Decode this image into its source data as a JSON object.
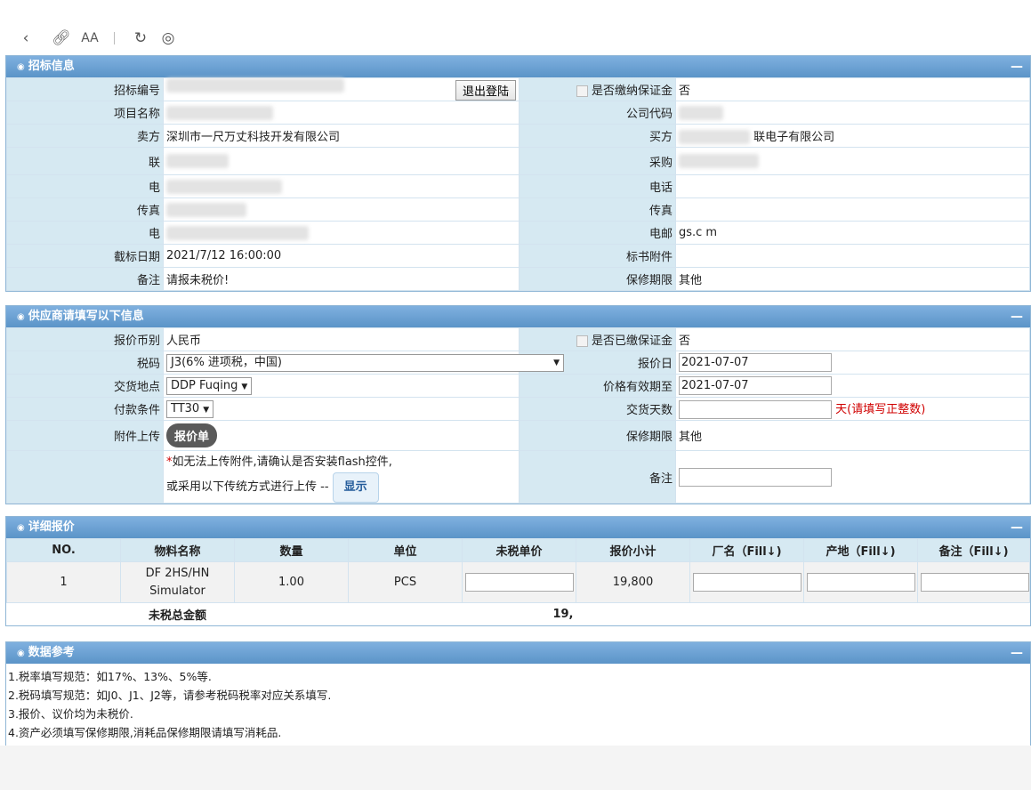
{
  "toolbar": {
    "icons": [
      "back-icon",
      "link-icon",
      "text-size-icon",
      "refresh-icon",
      "compass-icon"
    ],
    "text_size_glyph": "AA"
  },
  "bid_info": {
    "title": "招标信息",
    "collapse": "—",
    "bid_no_label": "招标编号",
    "logout_button": "退出登陆",
    "deposit_label": "是否缴纳保证金",
    "deposit_value": "否",
    "project_label": "项目名称",
    "company_code_label": "公司代码",
    "seller_label": "卖方",
    "seller_value": "深圳市一尺万丈科技开发有限公司",
    "buyer_label": "买方",
    "buyer_value": "联电子有限公司",
    "contact_label": "联",
    "purchaser_label": "采购",
    "phone_label_left": "电",
    "phone_label_right": "电话",
    "fax_label_left": "传真",
    "fax_label_right": "传真",
    "email_label_left": "电",
    "email_label_right": "电邮",
    "email_value_right": "gs.c  m",
    "deadline_label": "截标日期",
    "deadline_value": "2021/7/12 16:00:00",
    "attachment_label": "标书附件",
    "remark_label": "备注",
    "remark_value": "请报未税价!",
    "warranty_label": "保修期限",
    "warranty_value": "其他"
  },
  "supplier_info": {
    "title": "供应商请填写以下信息",
    "collapse": "—",
    "currency_label": "报价币别",
    "currency_value": "人民币",
    "deposit_label": "是否已缴保证金",
    "deposit_value": "否",
    "tax_label": "税码",
    "tax_value": "J3(6% 进项税，中国)",
    "quote_date_label": "报价日",
    "quote_date_value": "2021-07-07",
    "delivery_label": "交货地点",
    "delivery_value": "DDP Fuqing",
    "valid_until_label": "价格有效期至",
    "valid_until_value": "2021-07-07",
    "payment_label": "付款条件",
    "payment_value": "TT30",
    "delivery_days_label": "交货天数",
    "delivery_days_hint": "天(请填写正整数)",
    "upload_label": "附件上传",
    "upload_button": "报价单",
    "warranty_label": "保修期限",
    "warranty_value": "其他",
    "flash_note_star": "*",
    "flash_note": "如无法上传附件,请确认是否安装flash控件,",
    "legacy_note": "或采用以下传统方式进行上传 --",
    "show_button": "显示",
    "remark_label": "备注"
  },
  "detail": {
    "title": "详细报价",
    "collapse": "—",
    "headers": [
      "NO.",
      "物料名称",
      "数量",
      "单位",
      "未税单价",
      "报价小计",
      "厂名（Fill↓)",
      "产地（Fill↓)",
      "备注（Fill↓)"
    ],
    "row": {
      "no": "1",
      "material_line1": "DF   2HS/HN",
      "material_line2": "  Simulator",
      "qty": "1.00",
      "unit": "PCS",
      "subtotal": "19,800"
    },
    "total_label": "未税总金额",
    "total_value": "19,"
  },
  "reference": {
    "title": "数据参考",
    "collapse": "—",
    "lines": [
      "1.税率填写规范：如17%、13%、5%等.",
      "2.税码填写规范：如J0、J1、J2等，请参考税码税率对应关系填写.",
      "3.报价、议价均为未税价.",
      "4.资产必须填写保修期限,消耗品保修期限请填写消耗品."
    ]
  }
}
